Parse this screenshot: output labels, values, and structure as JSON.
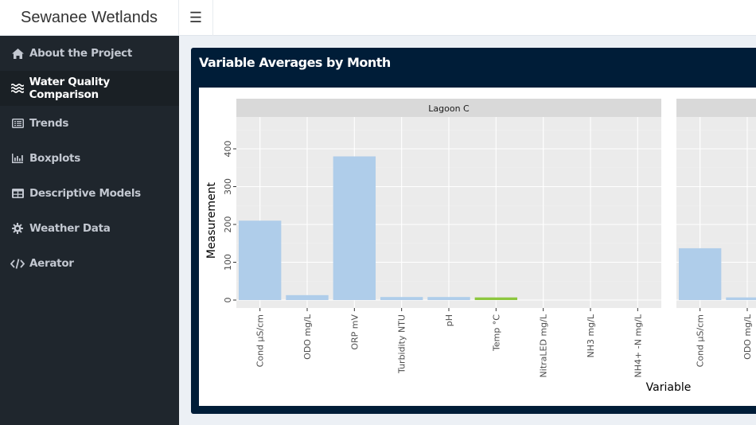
{
  "app": {
    "title": "Sewanee Wetlands",
    "menu_icon": "hamburger-icon"
  },
  "sidebar": {
    "items": [
      {
        "label": "About the Project",
        "icon": "home-icon",
        "active": false
      },
      {
        "label": "Water Quality Comparison",
        "icon": "water-icon",
        "active": true
      },
      {
        "label": "Trends",
        "icon": "list-alt-icon",
        "active": false
      },
      {
        "label": "Boxplots",
        "icon": "bar-chart-icon",
        "active": false
      },
      {
        "label": "Descriptive Models",
        "icon": "table-icon",
        "active": false
      },
      {
        "label": "Weather Data",
        "icon": "gear-icon",
        "active": false
      },
      {
        "label": "Aerator",
        "icon": "code-icon",
        "active": false
      }
    ]
  },
  "main": {
    "box_title": "Variable Averages by Month"
  },
  "colors": {
    "bar_default": "#afcdea",
    "bar_highlight": "#8dc63f",
    "panel_bg": "#ebebeb",
    "strip_bg": "#d9d9d9",
    "box_header": "#001d38"
  },
  "chart_data": {
    "type": "bar",
    "title": "Variable Averages by Month",
    "xlabel": "Variable",
    "ylabel": "Measurement",
    "ylim": [
      0,
      490
    ],
    "yticks": [
      0,
      100,
      200,
      300,
      400
    ],
    "grid": true,
    "categories": [
      "Cond µS/cm",
      "ODO mg/L",
      "ORP mV",
      "Turbidity NTU",
      "pH",
      "Temp °C",
      "NitraLED mg/L",
      "NH3 mg/L",
      "NH4+ -N mg/L"
    ],
    "facets": [
      {
        "name": "Lagoon C",
        "values": [
          210,
          13,
          380,
          8,
          8,
          7,
          0,
          0,
          0
        ],
        "highlight": [
          false,
          false,
          false,
          false,
          false,
          true,
          false,
          false,
          false
        ]
      },
      {
        "name": "",
        "values": [
          137,
          7,
          null,
          null,
          null,
          null,
          null,
          null,
          null
        ],
        "highlight": [
          false,
          false,
          false,
          false,
          false,
          false,
          false,
          false,
          false
        ]
      }
    ]
  }
}
